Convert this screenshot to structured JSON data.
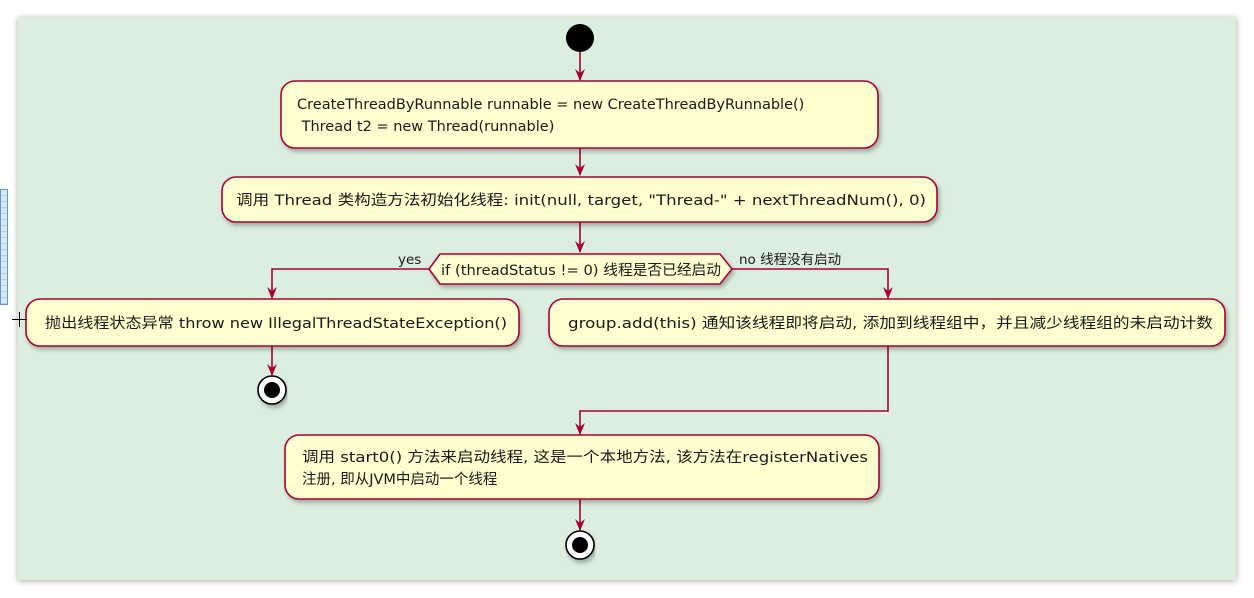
{
  "diagram": {
    "type": "activity",
    "nodes": {
      "create_runnable": {
        "line1": "CreateThreadByRunnable runnable = new CreateThreadByRunnable()",
        "line2": " Thread t2 = new Thread(runnable)"
      },
      "init_thread": {
        "text": "调用 Thread 类构造方法初始化线程: init(null, target, \"Thread-\" + nextThreadNum(), 0)"
      },
      "decision": {
        "text": "if (threadStatus != 0) 线程是否已经启动",
        "yes_label": "yes",
        "no_label": "no 线程没有启动"
      },
      "throw_exception": {
        "text": "抛出线程状态异常 throw new IllegalThreadStateException()"
      },
      "group_add": {
        "text": "group.add(this) 通知该线程即将启动, 添加到线程组中，并且减少线程组的未启动计数"
      },
      "start0": {
        "line1": "调用 start0() 方法来启动线程, 这是一个本地方法, 该方法在registerNatives",
        "line2": "注册, 即从JVM中启动一个线程"
      }
    }
  },
  "colors": {
    "background": "#dbeedf",
    "node_fill": "#fefece",
    "node_border": "#a80036",
    "arrow": "#a80036",
    "start_node": "#000000"
  }
}
